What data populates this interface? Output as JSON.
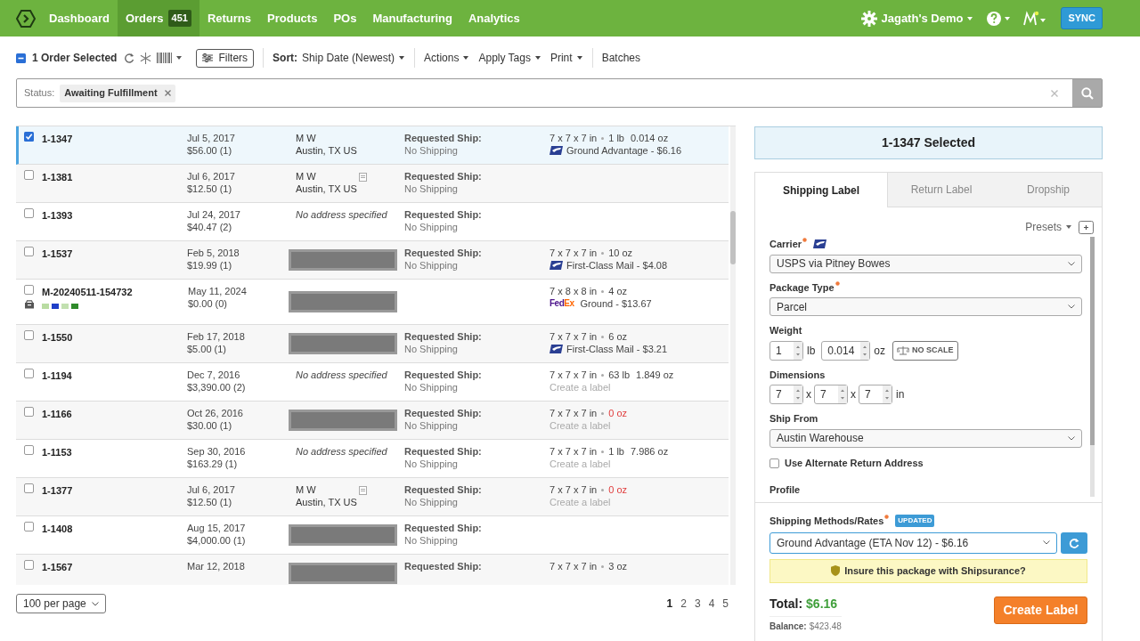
{
  "nav": {
    "items": [
      {
        "label": "Dashboard",
        "selected": false
      },
      {
        "label": "Orders",
        "selected": true,
        "badge": "451"
      },
      {
        "label": "Returns",
        "selected": false
      },
      {
        "label": "Products",
        "selected": false
      },
      {
        "label": "POs",
        "selected": false
      },
      {
        "label": "Manufacturing",
        "selected": false
      },
      {
        "label": "Analytics",
        "selected": false
      }
    ],
    "account": "Jagath's Demo",
    "sync": "SYNC"
  },
  "toolbar": {
    "selection": "1 Order Selected",
    "filters": "Filters",
    "sort_label": "Sort:",
    "sort_value": "Ship Date (Newest)",
    "menus": [
      "Actions",
      "Apply Tags",
      "Print"
    ],
    "batches": "Batches"
  },
  "filter_bar": {
    "label": "Status:",
    "tags": [
      "Awaiting Fulfillment"
    ]
  },
  "orders": [
    {
      "id": "1-1347",
      "checked": true,
      "selected": true,
      "date": "Jul 5, 2017",
      "total": "$56.00 (1)",
      "address": {
        "kind": "address",
        "name": "M W",
        "city": "Austin, TX US",
        "note": false
      },
      "requested": {
        "label": "Requested Ship:",
        "value": "No Shipping"
      },
      "shipment": {
        "dims": "7 x 7 x 7 in",
        "weight": [
          "1 lb",
          "0.014 oz"
        ],
        "weight_missing": false,
        "kind": "usps",
        "service": "Ground Advantage - $6.16"
      }
    },
    {
      "id": "1-1381",
      "checked": false,
      "selected": false,
      "date": "Jul 6, 2017",
      "total": "$12.50 (1)",
      "address": {
        "kind": "address",
        "name": "M W",
        "city": "Austin, TX US",
        "note": true
      },
      "requested": {
        "label": "Requested Ship:",
        "value": "No Shipping"
      }
    },
    {
      "id": "1-1393",
      "checked": false,
      "selected": false,
      "date": "Jul 24, 2017",
      "total": "$40.47 (2)",
      "address": {
        "kind": "none",
        "text": "No address specified"
      },
      "requested": {
        "label": "Requested Ship:",
        "value": "No Shipping"
      }
    },
    {
      "id": "1-1537",
      "checked": false,
      "selected": false,
      "date": "Feb 5, 2018",
      "total": "$19.99 (1)",
      "address": {
        "kind": "redacted"
      },
      "requested": {
        "label": "Requested Ship:",
        "value": "No Shipping"
      },
      "shipment": {
        "dims": "7 x 7 x 7 in",
        "weight": [
          "10 oz"
        ],
        "weight_missing": false,
        "kind": "usps",
        "service": "First-Class Mail - $4.08"
      }
    },
    {
      "id": "M-20240511-154732",
      "checked": false,
      "selected": false,
      "tags": [
        {
          "color": "#b9dca2"
        },
        {
          "color": "#1f3fc8"
        },
        {
          "color": "#c2e0b0"
        },
        {
          "color": "#2f8a2a"
        }
      ],
      "date": "May 11, 2024",
      "total": "$0.00 (0)",
      "address": {
        "kind": "redacted"
      },
      "shipment": {
        "dims": "7 x 8 x 8 in",
        "weight": [
          "4 oz"
        ],
        "weight_missing": false,
        "kind": "fedex",
        "carrier_logo": "FedEx",
        "service": "Ground - $13.67"
      }
    },
    {
      "id": "1-1550",
      "checked": false,
      "selected": false,
      "date": "Feb 17, 2018",
      "total": "$5.00 (1)",
      "address": {
        "kind": "redacted"
      },
      "requested": {
        "label": "Requested Ship:",
        "value": "No Shipping"
      },
      "shipment": {
        "dims": "7 x 7 x 7 in",
        "weight": [
          "6 oz"
        ],
        "weight_missing": false,
        "kind": "usps",
        "service": "First-Class Mail - $3.21"
      }
    },
    {
      "id": "1-1194",
      "checked": false,
      "selected": false,
      "date": "Dec 7, 2016",
      "total": "$3,390.00 (2)",
      "address": {
        "kind": "none",
        "text": "No address specified"
      },
      "requested": {
        "label": "Requested Ship:",
        "value": "No Shipping"
      },
      "shipment": {
        "dims": "7 x 7 x 7 in",
        "weight": [
          "63 lb",
          "1.849 oz"
        ],
        "weight_missing": false,
        "create": "Create a label"
      }
    },
    {
      "id": "1-1166",
      "checked": false,
      "selected": false,
      "date": "Oct 26, 2016",
      "total": "$30.00 (1)",
      "address": {
        "kind": "redacted"
      },
      "requested": {
        "label": "Requested Ship:",
        "value": "No Shipping"
      },
      "shipment": {
        "dims": "7 x 7 x 7 in",
        "weight": [
          "0 oz"
        ],
        "weight_missing": true,
        "create": "Create a label"
      }
    },
    {
      "id": "1-1153",
      "checked": false,
      "selected": false,
      "date": "Sep 30, 2016",
      "total": "$163.29 (1)",
      "address": {
        "kind": "none",
        "text": "No address specified"
      },
      "requested": {
        "label": "Requested Ship:",
        "value": "No Shipping"
      },
      "shipment": {
        "dims": "7 x 7 x 7 in",
        "weight": [
          "1 lb",
          "7.986 oz"
        ],
        "weight_missing": false,
        "create": "Create a label"
      }
    },
    {
      "id": "1-1377",
      "checked": false,
      "selected": false,
      "date": "Jul 6, 2017",
      "total": "$12.50 (1)",
      "address": {
        "kind": "address",
        "name": "M W",
        "city": "Austin, TX US",
        "note": true
      },
      "requested": {
        "label": "Requested Ship:",
        "value": "No Shipping"
      },
      "shipment": {
        "dims": "7 x 7 x 7 in",
        "weight": [
          "0 oz"
        ],
        "weight_missing": true,
        "create": "Create a label"
      }
    },
    {
      "id": "1-1408",
      "checked": false,
      "selected": false,
      "date": "Aug 15, 2017",
      "total": "$4,000.00 (1)",
      "address": {
        "kind": "redacted"
      },
      "requested": {
        "label": "Requested Ship:",
        "value": "No Shipping"
      }
    },
    {
      "id": "1-1567",
      "checked": false,
      "selected": false,
      "date": "Mar 12, 2018",
      "address": {
        "kind": "redacted"
      },
      "requested": {
        "label": "Requested Ship:"
      },
      "shipment": {
        "dims": "7 x 7 x 7 in",
        "weight": [
          "3 oz"
        ],
        "weight_missing": false
      }
    }
  ],
  "pagination": {
    "per_page": "100 per page",
    "pages": [
      {
        "label": "1",
        "selected": true
      },
      {
        "label": "2",
        "selected": false
      },
      {
        "label": "3",
        "selected": false
      },
      {
        "label": "4",
        "selected": false
      },
      {
        "label": "5",
        "selected": false
      }
    ]
  },
  "panel": {
    "title": "1-1347 Selected",
    "tabs": [
      {
        "label": "Shipping Label",
        "selected": true
      },
      {
        "label": "Return Label",
        "selected": false
      },
      {
        "label": "Dropship",
        "selected": false
      }
    ],
    "presets": "Presets",
    "carrier": {
      "label": "Carrier",
      "value": "USPS via Pitney Bowes"
    },
    "package": {
      "label": "Package Type",
      "value": "Parcel"
    },
    "weight": {
      "label": "Weight",
      "lb": "1",
      "lb_unit": "lb",
      "oz": "0.014",
      "oz_unit": "oz",
      "scale": "NO SCALE"
    },
    "dimensions": {
      "label": "Dimensions",
      "values": [
        "7",
        "7",
        "7"
      ],
      "separators": [
        "x",
        "x"
      ],
      "unit": "in"
    },
    "ship_from": {
      "label": "Ship From",
      "value": "Austin Warehouse"
    },
    "alternate_return": {
      "label": "Use Alternate Return Address",
      "checked": false
    },
    "profile": "Profile",
    "rates": {
      "label": "Shipping Methods/Rates",
      "badge": "UPDATED",
      "value": "Ground Advantage (ETA Nov 12) - $6.16"
    },
    "insurance": "Insure this package with Shipsurance?",
    "total_label": "Total:",
    "total": "$6.16",
    "balance_label": "Balance:",
    "balance": "$423.48",
    "create": "Create Label"
  }
}
